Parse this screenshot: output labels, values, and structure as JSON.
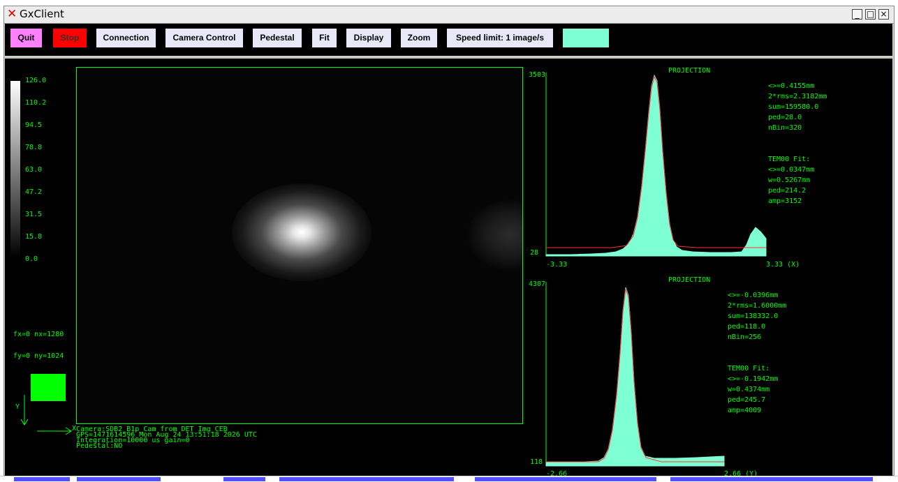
{
  "window": {
    "title": "GxClient",
    "controls": [
      "_",
      "□",
      "×"
    ]
  },
  "toolbar": {
    "quit": "Quit",
    "stop": "Stop",
    "connection": "Connection",
    "camera_control": "Camera Control",
    "pedestal": "Pedestal",
    "fit": "Fit",
    "display": "Display",
    "zoom": "Zoom",
    "speed_limit": "Speed limit: 1 image/s",
    "colors": {
      "quit_bg": "#ff80ff",
      "stop_bg": "#ff0000",
      "default_bg": "#e8e8f8",
      "status_swatch": "#7fffd4"
    }
  },
  "colorscale": {
    "labels": [
      "126.0",
      "110.2",
      "94.5",
      "78.8",
      "63.0",
      "47.2",
      "31.5",
      "15.8",
      "0.0"
    ]
  },
  "image_info": {
    "fx": "fx=0 nx=1280",
    "fy": "fy=0 ny=1024",
    "axis_y": "Y",
    "axis_x": "X",
    "lines": [
      "Camera:SDB2_B1p_Cam from DET_Img_CEB",
      "GPS=1471614596 Mon Aug 24 13:51:18 2026  UTC",
      "Integration=10000 us gain=0",
      "Pedestal:NO"
    ]
  },
  "projection_x": {
    "title": "PROJECTION",
    "ymax": "3503",
    "ymin": "28",
    "xmin": "-3.33",
    "xmax": "3.33 (X)",
    "stats": [
      "<>=0.4155mm",
      "2*rms=2.3182mm",
      "sum=159580.0",
      "ped=28.0",
      "nBin=320"
    ],
    "fit": [
      "TEM00 Fit:",
      "<>=0.0347mm",
      "w=0.5267mm",
      "ped=214.2",
      "amp=3152"
    ]
  },
  "projection_y": {
    "title": "PROJECTION",
    "ymax": "4307",
    "ymin": "118",
    "xmin": "-2.66",
    "xmax": "2.66 (Y)",
    "stats": [
      "<>=-0.0396mm",
      "2*rms=1.6000mm",
      "sum=138332.0",
      "ped=118.0",
      "nBin=256"
    ],
    "fit": [
      "TEM00 Fit:",
      "<>=-0.1942mm",
      "w=0.4374mm",
      "ped=245.7",
      "amp=4009"
    ]
  }
}
